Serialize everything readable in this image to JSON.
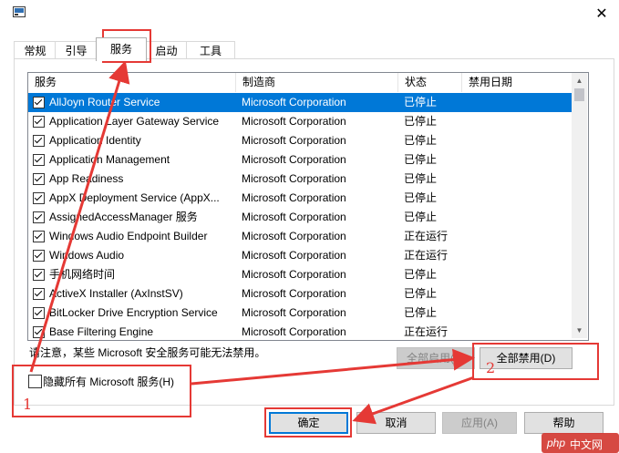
{
  "tabs": [
    {
      "label": "常规",
      "active": false
    },
    {
      "label": "引导",
      "active": false
    },
    {
      "label": "服务",
      "active": true
    },
    {
      "label": "启动",
      "active": false
    },
    {
      "label": "工具",
      "active": false
    }
  ],
  "table": {
    "columns": [
      "服务",
      "制造商",
      "状态",
      "禁用日期"
    ],
    "rows": [
      {
        "name": "AllJoyn Router Service",
        "maker": "Microsoft Corporation",
        "status": "已停止",
        "date": "",
        "checked": true,
        "selected": true
      },
      {
        "name": "Application Layer Gateway Service",
        "maker": "Microsoft Corporation",
        "status": "已停止",
        "date": "",
        "checked": true,
        "selected": false
      },
      {
        "name": "Application Identity",
        "maker": "Microsoft Corporation",
        "status": "已停止",
        "date": "",
        "checked": true,
        "selected": false
      },
      {
        "name": "Application Management",
        "maker": "Microsoft Corporation",
        "status": "已停止",
        "date": "",
        "checked": true,
        "selected": false
      },
      {
        "name": "App Readiness",
        "maker": "Microsoft Corporation",
        "status": "已停止",
        "date": "",
        "checked": true,
        "selected": false
      },
      {
        "name": "AppX Deployment Service (AppX...",
        "maker": "Microsoft Corporation",
        "status": "已停止",
        "date": "",
        "checked": true,
        "selected": false
      },
      {
        "name": "AssignedAccessManager 服务",
        "maker": "Microsoft Corporation",
        "status": "已停止",
        "date": "",
        "checked": true,
        "selected": false
      },
      {
        "name": "Windows Audio Endpoint Builder",
        "maker": "Microsoft Corporation",
        "status": "正在运行",
        "date": "",
        "checked": true,
        "selected": false
      },
      {
        "name": "Windows Audio",
        "maker": "Microsoft Corporation",
        "status": "正在运行",
        "date": "",
        "checked": true,
        "selected": false
      },
      {
        "name": "手机网络时间",
        "maker": "Microsoft Corporation",
        "status": "已停止",
        "date": "",
        "checked": true,
        "selected": false
      },
      {
        "name": "ActiveX Installer (AxInstSV)",
        "maker": "Microsoft Corporation",
        "status": "已停止",
        "date": "",
        "checked": true,
        "selected": false
      },
      {
        "name": "BitLocker Drive Encryption Service",
        "maker": "Microsoft Corporation",
        "status": "已停止",
        "date": "",
        "checked": true,
        "selected": false
      },
      {
        "name": "Base Filtering Engine",
        "maker": "Microsoft Corporation",
        "status": "正在运行",
        "date": "",
        "checked": true,
        "selected": false
      }
    ]
  },
  "note": "请注意，某些 Microsoft 安全服务可能无法禁用。",
  "buttons": {
    "enable_all": "全部启用(E)",
    "disable_all": "全部禁用(D)",
    "ok": "确定",
    "cancel": "取消",
    "apply": "应用(A)",
    "help": "帮助"
  },
  "hide_ms_services": {
    "label": "隐藏所有 Microsoft 服务(H)",
    "checked": false
  },
  "annotations": {
    "step1": "1",
    "step2": "2",
    "color": "#e53935"
  },
  "watermark": {
    "text1": "php",
    "text2": "中文网"
  },
  "icons": {
    "close": "close-icon",
    "window": "msconfig-icon"
  }
}
